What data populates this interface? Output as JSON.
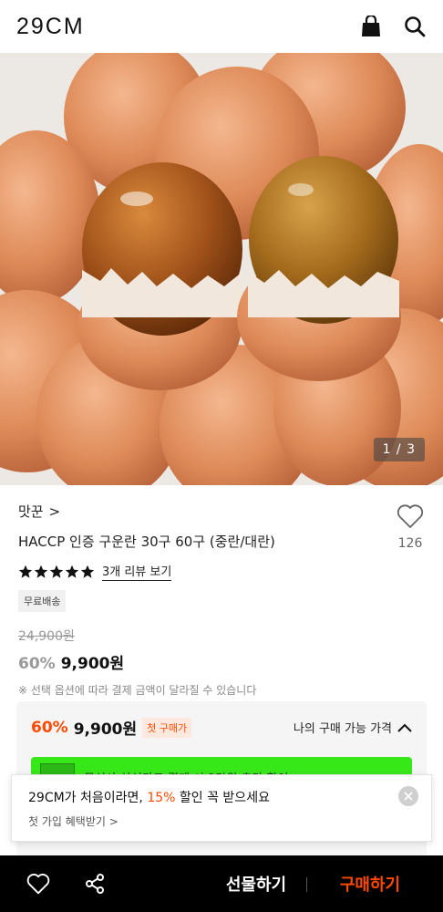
{
  "header": {
    "logo": "29CM",
    "cart_icon": "shopping-bag-icon",
    "search_icon": "search-icon"
  },
  "hero": {
    "counter": "1 / 3"
  },
  "product": {
    "brand": "맛꾼",
    "brand_chevron": ">",
    "title": "HACCP 인증 구운란 30구 60구 (중란/대란)",
    "like_count": "126",
    "rating_stars": 5,
    "review_link": "3개 리뷰 보기",
    "badge": "무료배송",
    "original_price": "24,900원",
    "discount_pct": "60%",
    "sale_price": "9,900원",
    "notice": "※ 선택 옵션에 따라 결제 금액이 달라질 수 있습니다"
  },
  "first_purchase": {
    "pct": "60%",
    "price": "9,900원",
    "tag": "첫 구매가",
    "my_price_label": "나의 구매 가능 가격",
    "banner_text": "무신사 삼성카드 결제 시 2만원 추가 할인"
  },
  "popup": {
    "title_prefix": "29CM가 처음이라면, ",
    "title_highlight": "15%",
    "title_suffix": " 할인 꼭 받으세요",
    "sub": "첫 가입 혜택받기 >"
  },
  "bottom_bar": {
    "gift_label": "선물하기",
    "buy_label": "구매하기"
  },
  "colors": {
    "accent": "#ff4800",
    "banner_green": "#37e818",
    "bar_bg": "#000000"
  }
}
